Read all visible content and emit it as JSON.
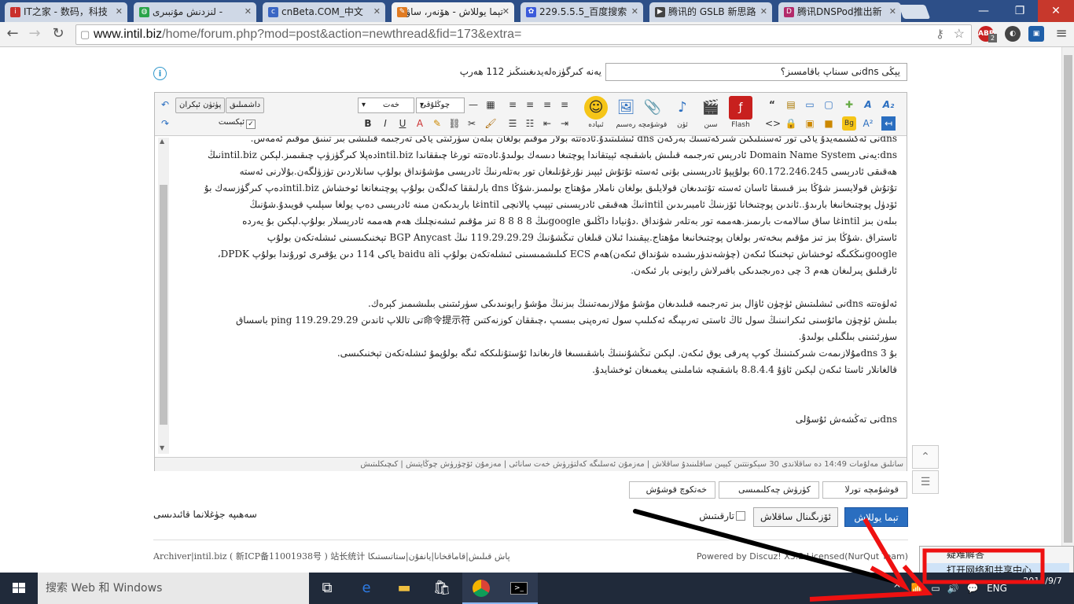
{
  "browser": {
    "tabs": [
      {
        "title": "IT之家 - 数码，科技",
        "icon": "ithome-icon",
        "color": "#c9302c"
      },
      {
        "title": "لنزدنش مۇنبىرى -",
        "icon": "globe-icon",
        "color": "#2aa44a"
      },
      {
        "title": "cnBeta.COM_中文",
        "icon": "cnbeta-icon",
        "color": "#3a66c4"
      },
      {
        "title": "تېما يوللاش - ھۆنەر، ساۋا",
        "icon": "forum-icon",
        "color": "#e07b22"
      },
      {
        "title": "229.5.5.5_百度搜索",
        "icon": "baidu-icon",
        "color": "#3b5bdb"
      },
      {
        "title": "腾讯的 GSLB 新思路",
        "icon": "tencent-icon",
        "color": "#444"
      },
      {
        "title": "腾讯DNSPod推出新",
        "icon": "dnspod-icon",
        "color": "#b22a6a"
      }
    ],
    "url_domain": "www.intil.biz",
    "url_path": "/home/forum.php?mod=post&action=newthread&fid=173&extra=",
    "abp_badge": "2",
    "window_buttons": {
      "minimize": "—",
      "maximize": "❐",
      "close": "✕"
    }
  },
  "form": {
    "subject_value": "يېڭى dnsنى سىناپ باقامسىز؟",
    "subject_hint": "يەنە كىرگۈزەلەيدىغىنىڭىز 112 ھەرپ",
    "toolbar": {
      "flash_label": "Flash",
      "video_label": "سىن",
      "audio_label": "ئۈن",
      "attach_label": "قوشۇمچە",
      "image_label": "رەسىم",
      "emoji_label": "ئىپادە",
      "font_label": "خەت",
      "size_label": "چوڭلۇقى",
      "advanced_label": "پۈتۈن ئېكران",
      "save_label": "داشمىلىق",
      "simple_label": "ئېكسىت"
    },
    "body_lines": [
      "dnsنى ئەكشىمەيدۇ ياكى تور ئەسنىلىكىن شىركەتسىڭ بەرگەن dns ئىشلىتىدۇ.ئادەتتە بولار موقىم بولغان بىلەن سۈرئىتى ياكى تەرجىمە قىلىشى بىر تىنىق موقىم ئەمەس.",
      "dns:يەنى Domain Name System ئادرېس تەرجىمە قىلىش باشقىچە ئېيتقاندا پوچتىغا دىسەك بولىدۇ.ئادەتتە تورغا چىققاندا intil.bizدەپلا كىرگۈزۈپ چىقىمىز.لېكىن intil.bizنىڭ",
      "ھەقىقى ئادرېسى 60.172.246.245 بولۇپپۇ ئادرېسىنى بۇنى ئەستە تۇتۇش ئېپىز نۇرغۇنلىغان تور بەتلەرنىڭ ئادرېسى مۇشۇنداق بولۇپ سانلاردىن تۈزۈلگەن.بۇلارنى ئەستە",
      "تۇتۇش قولايسىز شۇڭا بىز قىسقا ئاسان ئەستە تۇتىدىغان قولايلىق بولغان ناملار مۇھتاج بولىمىز.شۇڭا dns بارلىققا كەلگەن بولۇپ پوچتىغانغا ئوخشاش intil.bizدەپ كىرگۈزسەك بۇ",
      "ئۆدۈل پوچتىخانىغا بارىدۇ..ئاندىن پوچتىخانا ئۆزىنىڭ ئامبىرىدىن intilنىڭ ھەقىقى ئادرېسىنى تېپىپ پالانچى intilغا باربدىكەن مىنە ئادرېسى دەپ  يولغا سېلىپ قويىدۇ.شۇنىڭ",
      "بىلەن بىز intilغا ساق سالامەت بارىمىز.ھەممە تور بەتلەر شۇنداق .دۇنيادا داڭلىق googleنىڭ 8 8 8 8 تىز مۇقىم ئىشەنچلىك ھەم ھەممە ئادرېسلار بولۇپ.لېكىن بۇ يەردە",
      "ئاستراق .شۇڭا بىز تىز مۇقىم بىخەتەر بولغان پوچتىخانىغا مۇھتاج.يېقىندا ئىلان قىلغان تىڭشۇنىڭ 119.29.29.29 نىڭ BGP Anycast تېخنىكىسىنى ئىشلەتكەن بولۇپ",
      "googleنىڭكىگە ئوخشاش تېخنىكا ئىكەن (چۈشەندۈرىشىدە شۇنداق ئىكەن)ھەم ECS كىلىشمىسىنى ئىشلەتكەن بولۇپ  baidu ali ياكى 114 دىن يۇقىرى ئورۇندا بولۇپ  DPDK،",
      "ئارقىلىق پىرلىغان ھەم 3 چى دەرىجىدىكى بافىرلاش رايونى بار ئىكەن.",
      "",
      "ئەلۋەتتە  dnsنى ئىشلىتىش ئۈچۈن ئاۋال بىز تەرجىمە قىلىدىغان مۇشۇ مۇلازىمەتىنىڭ  بىزنىڭ مۇشۇ رايونىدىكى سۈرئىتىنى بىلىشىمىز كېرەك.",
      "بىلىش ئۈچۈن مائۇسنى ئىكرانىنىڭ سول  ئاڭ ئاستى تەرىپىگە ئەكىلىپ سول تەرەپنى بىسىپ ،چىققان كوزنەكتىن 命令提示符تى تاللاپ ئاندىن ping 119.29.29.29  باسساق",
      "سۈرئىتىنى بىلگىلى بولىدۇ.",
      "بۇ 3 dnsمۇلازىمەت شىركىتىنىڭ  كوپ پەرقى يوق ئىكەن. لېكىن تىڭشۇنىنىڭ  باشقىسىغا قارىغاندا ئۇستۇنلىككە ئىگە  بولۇپمۇ ئىشلەتكەن تېخنىكىسى.",
      "قالغانلار ئاستا ئىكەن لېكىن ئاۋۇ 8.8.4.4  باشقىچە شاملىنى يىغمىغان ئوخشايدۇ.",
      "",
      "",
      "dnsنى تەڭشەش ئۇسۇلى"
    ],
    "status_text": "سانلىق مەلۇمات 14:49 دە ساقلاندى     30 سېكونتتىن كېيىن ساقلىنىدۇ ساقلاش | مەزمۇن ئەسلىگە كەلتۈرۈش      خەت سانائى | مەزمۇن ئۆچۈرۈش     چوڭايتىش | كىچىكلىتىش",
    "sub_options": [
      "قوشۇمچە تورلا",
      "كۈرۈش چەكلىمىسى",
      "خەتكوچ قوشۇش"
    ],
    "post_button": "تېما يوللاش",
    "draft_button": "ئۆزىگىنال ساقلاش",
    "agree_label": "تارقىتىش",
    "left_link": "سەھىپە جۈغلانما قائىدىسى"
  },
  "footer": {
    "left": "Archiver|intil.biz ( 新ICP备11001938号 )   站长统计  پاش قىلىش|قاماقخانا|يانفۇن|ستاتىستىكا",
    "right": "Powered by Discuz! X3.2 Licensed(NurQut Team)"
  },
  "context_menu": {
    "item1": "疑难解答",
    "item2": "打开网络和共享中心"
  },
  "taskbar": {
    "search_placeholder": "搜索 Web 和 Windows",
    "lang": "ENG",
    "time": "",
    "date": "2015/9/7"
  }
}
